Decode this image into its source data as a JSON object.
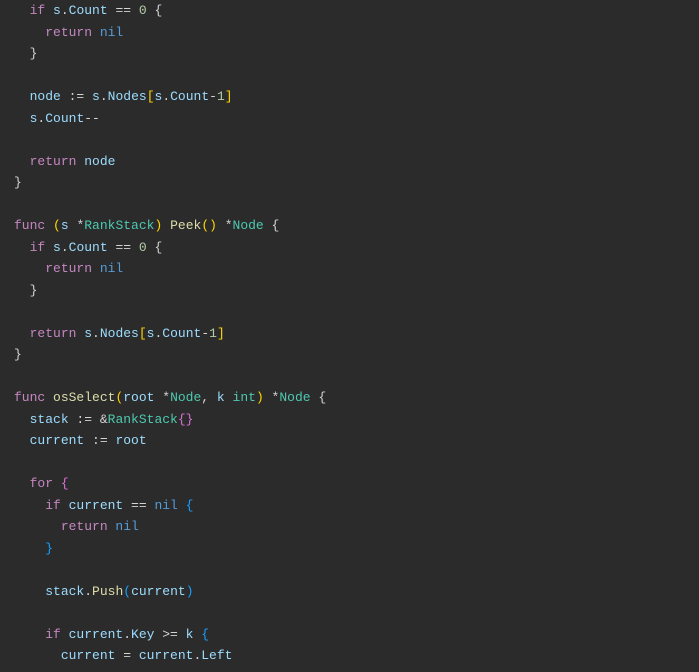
{
  "code": {
    "lines": [
      {
        "indent": 1,
        "tokens": [
          {
            "t": "if ",
            "c": "kw"
          },
          {
            "t": "s",
            "c": "ident"
          },
          {
            "t": ".",
            "c": "op"
          },
          {
            "t": "Count",
            "c": "prop"
          },
          {
            "t": " == ",
            "c": "op"
          },
          {
            "t": "0",
            "c": "num"
          },
          {
            "t": " {",
            "c": "punc"
          }
        ]
      },
      {
        "indent": 2,
        "tokens": [
          {
            "t": "return ",
            "c": "kw"
          },
          {
            "t": "nil",
            "c": "nil"
          }
        ]
      },
      {
        "indent": 1,
        "tokens": [
          {
            "t": "}",
            "c": "punc"
          }
        ]
      },
      {
        "indent": 0,
        "tokens": []
      },
      {
        "indent": 1,
        "tokens": [
          {
            "t": "node",
            "c": "ident"
          },
          {
            "t": " := ",
            "c": "op"
          },
          {
            "t": "s",
            "c": "ident"
          },
          {
            "t": ".",
            "c": "op"
          },
          {
            "t": "Nodes",
            "c": "prop"
          },
          {
            "t": "[",
            "c": "paren"
          },
          {
            "t": "s",
            "c": "ident"
          },
          {
            "t": ".",
            "c": "op"
          },
          {
            "t": "Count",
            "c": "prop"
          },
          {
            "t": "-",
            "c": "op"
          },
          {
            "t": "1",
            "c": "num"
          },
          {
            "t": "]",
            "c": "paren"
          }
        ]
      },
      {
        "indent": 1,
        "tokens": [
          {
            "t": "s",
            "c": "ident"
          },
          {
            "t": ".",
            "c": "op"
          },
          {
            "t": "Count",
            "c": "prop"
          },
          {
            "t": "--",
            "c": "op"
          }
        ]
      },
      {
        "indent": 0,
        "tokens": []
      },
      {
        "indent": 1,
        "tokens": [
          {
            "t": "return ",
            "c": "kw"
          },
          {
            "t": "node",
            "c": "ident"
          }
        ]
      },
      {
        "indent": 0,
        "tokens": [
          {
            "t": "}",
            "c": "punc"
          }
        ]
      },
      {
        "indent": 0,
        "tokens": []
      },
      {
        "indent": 0,
        "tokens": [
          {
            "t": "func ",
            "c": "kw"
          },
          {
            "t": "(",
            "c": "paren"
          },
          {
            "t": "s",
            "c": "ident"
          },
          {
            "t": " *",
            "c": "op"
          },
          {
            "t": "RankStack",
            "c": "type"
          },
          {
            "t": ")",
            "c": "paren"
          },
          {
            "t": " ",
            "c": "op"
          },
          {
            "t": "Peek",
            "c": "func"
          },
          {
            "t": "()",
            "c": "paren"
          },
          {
            "t": " *",
            "c": "op"
          },
          {
            "t": "Node",
            "c": "type"
          },
          {
            "t": " {",
            "c": "punc"
          }
        ]
      },
      {
        "indent": 1,
        "tokens": [
          {
            "t": "if ",
            "c": "kw"
          },
          {
            "t": "s",
            "c": "ident"
          },
          {
            "t": ".",
            "c": "op"
          },
          {
            "t": "Count",
            "c": "prop"
          },
          {
            "t": " == ",
            "c": "op"
          },
          {
            "t": "0",
            "c": "num"
          },
          {
            "t": " {",
            "c": "punc"
          }
        ]
      },
      {
        "indent": 2,
        "tokens": [
          {
            "t": "return ",
            "c": "kw"
          },
          {
            "t": "nil",
            "c": "nil"
          }
        ]
      },
      {
        "indent": 1,
        "tokens": [
          {
            "t": "}",
            "c": "punc"
          }
        ]
      },
      {
        "indent": 0,
        "tokens": []
      },
      {
        "indent": 1,
        "tokens": [
          {
            "t": "return ",
            "c": "kw"
          },
          {
            "t": "s",
            "c": "ident"
          },
          {
            "t": ".",
            "c": "op"
          },
          {
            "t": "Nodes",
            "c": "prop"
          },
          {
            "t": "[",
            "c": "paren"
          },
          {
            "t": "s",
            "c": "ident"
          },
          {
            "t": ".",
            "c": "op"
          },
          {
            "t": "Count",
            "c": "prop"
          },
          {
            "t": "-",
            "c": "op"
          },
          {
            "t": "1",
            "c": "num"
          },
          {
            "t": "]",
            "c": "paren"
          }
        ]
      },
      {
        "indent": 0,
        "tokens": [
          {
            "t": "}",
            "c": "punc"
          }
        ]
      },
      {
        "indent": 0,
        "tokens": []
      },
      {
        "indent": 0,
        "tokens": [
          {
            "t": "func ",
            "c": "kw"
          },
          {
            "t": "osSelect",
            "c": "func"
          },
          {
            "t": "(",
            "c": "paren"
          },
          {
            "t": "root",
            "c": "ident"
          },
          {
            "t": " *",
            "c": "op"
          },
          {
            "t": "Node",
            "c": "type"
          },
          {
            "t": ", ",
            "c": "op"
          },
          {
            "t": "k",
            "c": "ident"
          },
          {
            "t": " ",
            "c": "op"
          },
          {
            "t": "int",
            "c": "type"
          },
          {
            "t": ")",
            "c": "paren"
          },
          {
            "t": " *",
            "c": "op"
          },
          {
            "t": "Node",
            "c": "type"
          },
          {
            "t": " {",
            "c": "punc"
          }
        ]
      },
      {
        "indent": 1,
        "tokens": [
          {
            "t": "stack",
            "c": "ident"
          },
          {
            "t": " := &",
            "c": "op"
          },
          {
            "t": "RankStack",
            "c": "type"
          },
          {
            "t": "{}",
            "c": "brace"
          }
        ]
      },
      {
        "indent": 1,
        "tokens": [
          {
            "t": "current",
            "c": "ident"
          },
          {
            "t": " := ",
            "c": "op"
          },
          {
            "t": "root",
            "c": "ident"
          }
        ]
      },
      {
        "indent": 0,
        "tokens": []
      },
      {
        "indent": 1,
        "tokens": [
          {
            "t": "for ",
            "c": "kw"
          },
          {
            "t": "{",
            "c": "brace"
          }
        ]
      },
      {
        "indent": 2,
        "tokens": [
          {
            "t": "if ",
            "c": "kw"
          },
          {
            "t": "current",
            "c": "ident"
          },
          {
            "t": " == ",
            "c": "op"
          },
          {
            "t": "nil",
            "c": "nil"
          },
          {
            "t": " {",
            "c": "brace2"
          }
        ]
      },
      {
        "indent": 3,
        "tokens": [
          {
            "t": "return ",
            "c": "kw"
          },
          {
            "t": "nil",
            "c": "nil"
          }
        ]
      },
      {
        "indent": 2,
        "tokens": [
          {
            "t": "}",
            "c": "brace2"
          }
        ]
      },
      {
        "indent": 0,
        "tokens": []
      },
      {
        "indent": 2,
        "tokens": [
          {
            "t": "stack",
            "c": "ident"
          },
          {
            "t": ".",
            "c": "op"
          },
          {
            "t": "Push",
            "c": "func"
          },
          {
            "t": "(",
            "c": "brace2"
          },
          {
            "t": "current",
            "c": "ident"
          },
          {
            "t": ")",
            "c": "brace2"
          }
        ]
      },
      {
        "indent": 0,
        "tokens": []
      },
      {
        "indent": 2,
        "tokens": [
          {
            "t": "if ",
            "c": "kw"
          },
          {
            "t": "current",
            "c": "ident"
          },
          {
            "t": ".",
            "c": "op"
          },
          {
            "t": "Key",
            "c": "prop"
          },
          {
            "t": " >= ",
            "c": "op"
          },
          {
            "t": "k",
            "c": "ident"
          },
          {
            "t": " {",
            "c": "brace2"
          }
        ]
      },
      {
        "indent": 3,
        "tokens": [
          {
            "t": "current",
            "c": "ident"
          },
          {
            "t": " = ",
            "c": "op"
          },
          {
            "t": "current",
            "c": "ident"
          },
          {
            "t": ".",
            "c": "op"
          },
          {
            "t": "Left",
            "c": "prop"
          }
        ]
      }
    ]
  }
}
